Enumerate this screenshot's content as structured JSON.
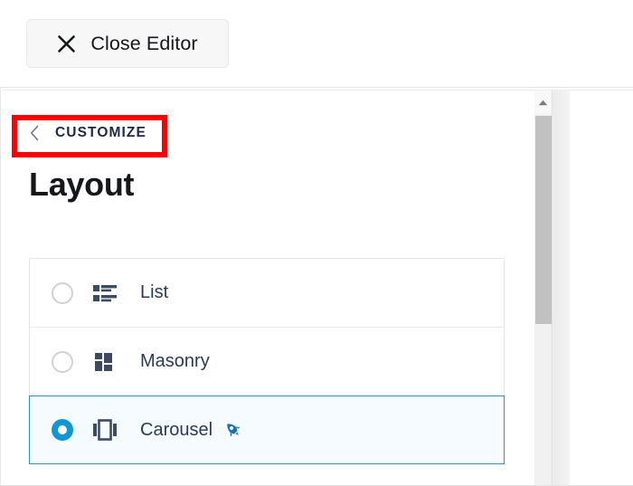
{
  "topbar": {
    "close_editor": {
      "label": "Close Editor",
      "icon": "close-x-icon"
    }
  },
  "panel": {
    "back": {
      "label": "CUSTOMIZE",
      "icon": "chevron-left-icon"
    },
    "title": "Layout",
    "annotation": {
      "type": "red-highlight-rectangle",
      "color": "#ff0000",
      "target": "customize-back-link"
    },
    "options": [
      {
        "label": "List",
        "icon": "list-view-icon",
        "selected": false,
        "badge": ""
      },
      {
        "label": "Masonry",
        "icon": "masonry-grid-icon",
        "selected": false,
        "badge": ""
      },
      {
        "label": "Carousel",
        "icon": "carousel-icon",
        "selected": true,
        "badge": "rocket-emoji"
      }
    ]
  },
  "scrollbar": {
    "up_arrow_icon": "scroll-up-arrow-icon",
    "thumb_color": "#c1c1c1",
    "track_color": "#f1f1f1"
  },
  "colors": {
    "accent": "#0d97d5",
    "selected_border": "#2e8fc4",
    "selected_bg": "#f5fbfe",
    "text_dark": "#15171a",
    "text_option": "#2c3a52",
    "annotation": "#ff0000"
  }
}
